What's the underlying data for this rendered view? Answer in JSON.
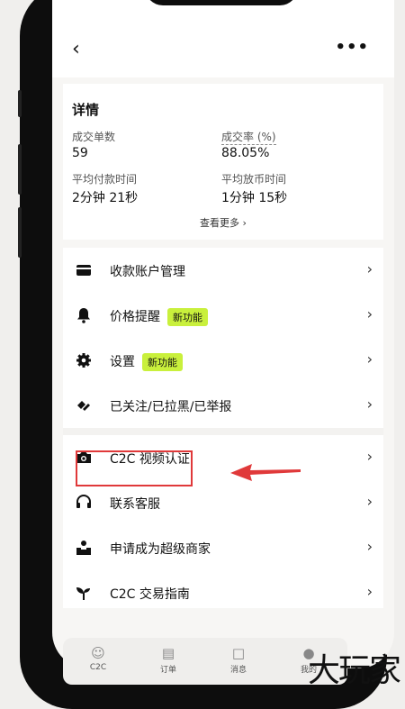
{
  "nav": {
    "back": "‹",
    "more": "•••"
  },
  "details": {
    "title": "详情",
    "trades_label": "成交单数",
    "trades_value": "59",
    "rate_label": "成交率 (%)",
    "rate_value": "88.05%",
    "pay_time_label": "平均付款时间",
    "pay_time_value": "2分钟 21秒",
    "release_time_label": "平均放币时间",
    "release_time_value": "1分钟 15秒",
    "see_more": "查看更多 ›"
  },
  "menu": [
    {
      "label": "收款账户管理",
      "icon": "card-icon",
      "badge": ""
    },
    {
      "label": "价格提醒",
      "icon": "bell-icon",
      "badge": "新功能"
    },
    {
      "label": "设置",
      "icon": "gear-icon",
      "badge": "新功能"
    },
    {
      "label": "已关注/已拉黑/已举报",
      "icon": "diamond-icon",
      "badge": ""
    },
    {
      "label": "C2C 视频认证",
      "icon": "camera-icon",
      "badge": ""
    },
    {
      "label": "联系客服",
      "icon": "headset-icon",
      "badge": ""
    },
    {
      "label": "申请成为超级商家",
      "icon": "merchant-icon",
      "badge": ""
    },
    {
      "label": "C2C 交易指南",
      "icon": "sprout-icon",
      "badge": ""
    }
  ],
  "chevron": "›",
  "tabs": [
    {
      "label": "C2C"
    },
    {
      "label": "订单"
    },
    {
      "label": "消息"
    },
    {
      "label": "我的"
    }
  ],
  "colors": {
    "accent": "#c9f03c",
    "annotation": "#e0393a"
  },
  "watermark": "大玩家"
}
